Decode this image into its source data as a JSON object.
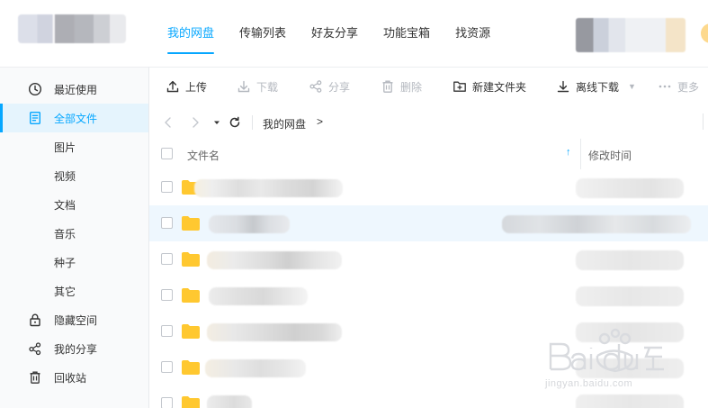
{
  "nav": {
    "tabs": [
      {
        "label": "我的网盘",
        "active": true
      },
      {
        "label": "传输列表"
      },
      {
        "label": "好友分享"
      },
      {
        "label": "功能宝箱"
      },
      {
        "label": "找资源"
      }
    ]
  },
  "sidebar": {
    "items": [
      {
        "label": "最近使用",
        "icon": "clock-icon"
      },
      {
        "label": "全部文件",
        "icon": "document-icon",
        "active": true
      },
      {
        "label": "图片"
      },
      {
        "label": "视频"
      },
      {
        "label": "文档"
      },
      {
        "label": "音乐"
      },
      {
        "label": "种子"
      },
      {
        "label": "其它"
      },
      {
        "label": "隐藏空间",
        "icon": "lock-icon"
      },
      {
        "label": "我的分享",
        "icon": "share-icon"
      },
      {
        "label": "回收站",
        "icon": "trash-icon"
      }
    ]
  },
  "toolbar": {
    "upload": "上传",
    "download": "下载",
    "share": "分享",
    "delete": "删除",
    "new_folder": "新建文件夹",
    "offline_download": "离线下载",
    "more": "更多"
  },
  "breadcrumb": {
    "current": "我的网盘",
    "arrow": ">"
  },
  "table": {
    "col_name": "文件名",
    "col_modified": "修改时间",
    "sort_indicator": "↑",
    "row_count": 7
  },
  "watermark": {
    "text": "jingyan.baidu.com"
  },
  "colors": {
    "accent": "#06a7ff",
    "folder": "#ffc830",
    "row_highlight": "#eef7fe"
  }
}
